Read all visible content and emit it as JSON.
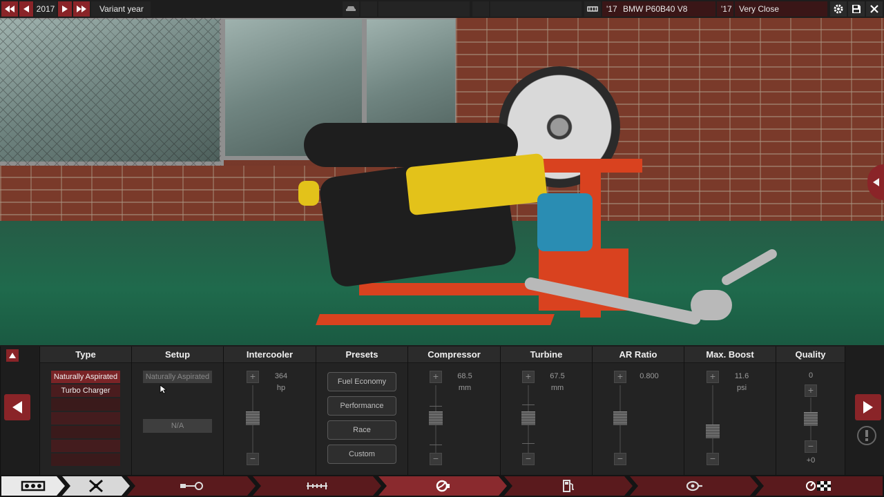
{
  "topbar": {
    "year": "2017",
    "variant_label": "Variant year",
    "engine_year": "'17",
    "engine_name": "BMW P60B40 V8",
    "match_year": "'17",
    "match_label": "Very Close"
  },
  "panel": {
    "columns": {
      "type": "Type",
      "setup": "Setup",
      "intercooler": "Intercooler",
      "presets": "Presets",
      "compressor": "Compressor",
      "turbine": "Turbine",
      "ar_ratio": "AR Ratio",
      "max_boost": "Max. Boost",
      "quality": "Quality"
    },
    "type_options": [
      "Naturally Aspirated",
      "Turbo Charger"
    ],
    "setup": {
      "value": "Naturally Aspirated",
      "na": "N/A"
    },
    "intercooler": {
      "value": "364",
      "unit": "hp"
    },
    "presets": [
      "Fuel Economy",
      "Performance",
      "Race",
      "Custom"
    ],
    "compressor": {
      "value": "68.5",
      "unit": "mm"
    },
    "turbine": {
      "value": "67.5",
      "unit": "mm"
    },
    "ar_ratio": {
      "value": "0.800"
    },
    "max_boost": {
      "value": "11.6",
      "unit": "psi"
    },
    "quality": {
      "value": "0",
      "bonus": "+0"
    }
  },
  "colors": {
    "accent_red": "#8a2428",
    "selected_red": "#7a2427",
    "panel_bg": "#232323"
  },
  "nav_icons": [
    "engine-block-icon",
    "engine-heads-icon",
    "crankshaft-icon",
    "intake-manifold-icon",
    "turbo-icon",
    "fuel-pump-icon",
    "exhaust-icon",
    "test-results-icon"
  ]
}
